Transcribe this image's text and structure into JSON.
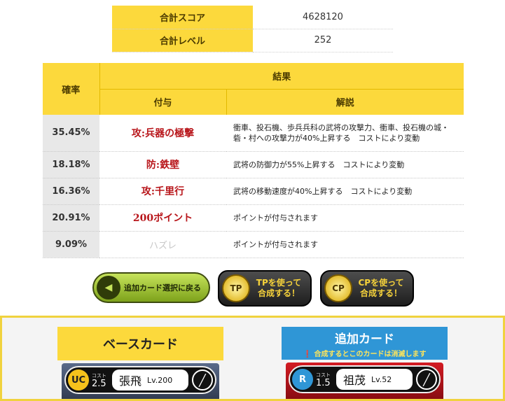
{
  "summary": {
    "rows": [
      {
        "label": "合計スコア",
        "value": "4628120"
      },
      {
        "label": "合計レベル",
        "value": "252"
      }
    ]
  },
  "result_table": {
    "headers": {
      "rate": "確率",
      "result": "結果",
      "effect": "付与",
      "description": "解説"
    },
    "rows": [
      {
        "rate": "35.45%",
        "effect": "攻:兵器の極撃",
        "description": "衝車、投石機、歩兵兵科の武将の攻撃力、衝車、投石機の城・砦・村への攻撃力が40%上昇する　コストにより変動"
      },
      {
        "rate": "18.18%",
        "effect": "防:鉄壁",
        "description": "武将の防御力が55%上昇する　コストにより変動"
      },
      {
        "rate": "16.36%",
        "effect": "攻:千里行",
        "description": "武将の移動速度が40%上昇する　コストにより変動"
      },
      {
        "rate": "20.91%",
        "effect": "200ポイント",
        "description": "ポイントが付与されます"
      },
      {
        "rate": "9.09%",
        "effect": "ハズレ",
        "description": "ポイントが付与されます"
      }
    ]
  },
  "buttons": {
    "back": "追加カード選択に戻る",
    "tp": {
      "badge": "TP",
      "line1": "TPを使って",
      "line2": "合成する！"
    },
    "cp": {
      "badge": "CP",
      "line1": "CPを使って",
      "line2": "合成する！"
    }
  },
  "base_card": {
    "title": "ベースカード",
    "rarity": "UC",
    "cost_label": "コスト",
    "cost": "2.5",
    "name": "張飛",
    "level": "Lv.200"
  },
  "add_card": {
    "title": "追加カード",
    "note": "合成するとこのカードは消滅します",
    "rarity": "R",
    "cost_label": "コスト",
    "cost": "1.5",
    "name": "祖茂",
    "level": "Lv.52"
  }
}
